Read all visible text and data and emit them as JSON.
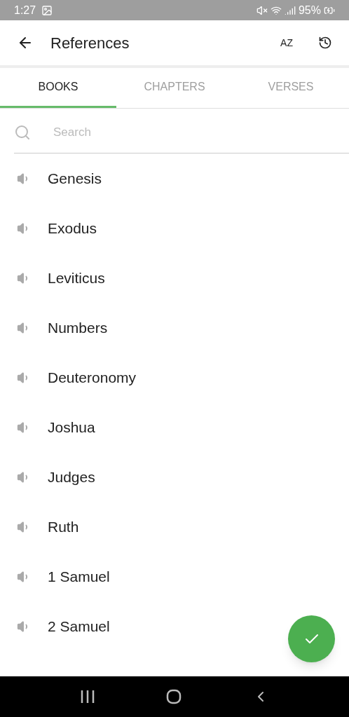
{
  "status_bar": {
    "time": "1:27",
    "battery": "95%"
  },
  "app_bar": {
    "title": "References",
    "sort_label": "AZ"
  },
  "tabs": [
    {
      "label": "BOOKS",
      "selected": true
    },
    {
      "label": "CHAPTERS",
      "selected": false
    },
    {
      "label": "VERSES",
      "selected": false
    }
  ],
  "search": {
    "placeholder": "Search"
  },
  "books": [
    "Genesis",
    "Exodus",
    "Leviticus",
    "Numbers",
    "Deuteronomy",
    "Joshua",
    "Judges",
    "Ruth",
    "1 Samuel",
    "2 Samuel"
  ]
}
